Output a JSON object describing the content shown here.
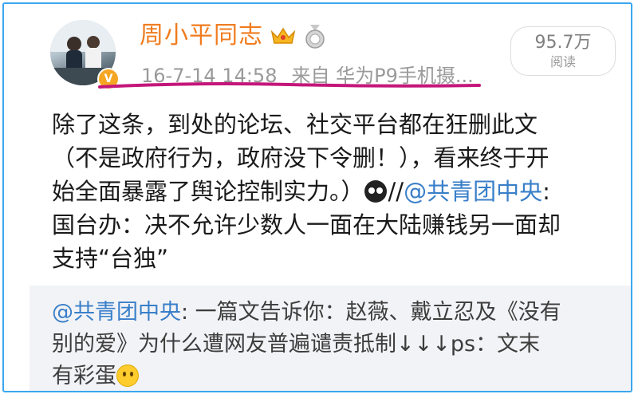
{
  "header": {
    "username": "周小平同志",
    "timestamp": "16-7-14 14:58",
    "source_prefix": "来自",
    "source_device": "华为P9手机摄...",
    "verified_mark": "V",
    "crown_icon": "crown-icon",
    "medal_icon": "medal-icon"
  },
  "stats": {
    "views_count": "95.7万",
    "views_label": "阅读"
  },
  "post": {
    "line1": "除了这条，到处的论坛、社交平台都在狂删此文",
    "line2": "（不是政府行为，政府没下令删！），看来终于开",
    "line3_text": "始全面暴露了舆论控制实力。）",
    "line3_sep": "//",
    "line3_mention": "@共青团中央",
    "line3_colon": ":",
    "line4": "国台办：决不允许少数人一面在大陆赚钱另一面却",
    "line5": "支持“台独”"
  },
  "repost": {
    "mention": "@共青团中央",
    "line1_rest": ": 一篇文告诉你：赵薇、戴立忍及《没有",
    "line2": "别的爱》为什么遭网友普遍谴责抵制↓↓↓ps：文末",
    "line3": "有彩蛋"
  },
  "colors": {
    "username": "#f07c1f",
    "mention": "#3a7fc9",
    "frame_border": "#3aa6f0",
    "annotation_underline": "#c4167a",
    "repost_bg": "#f2f3f6"
  }
}
